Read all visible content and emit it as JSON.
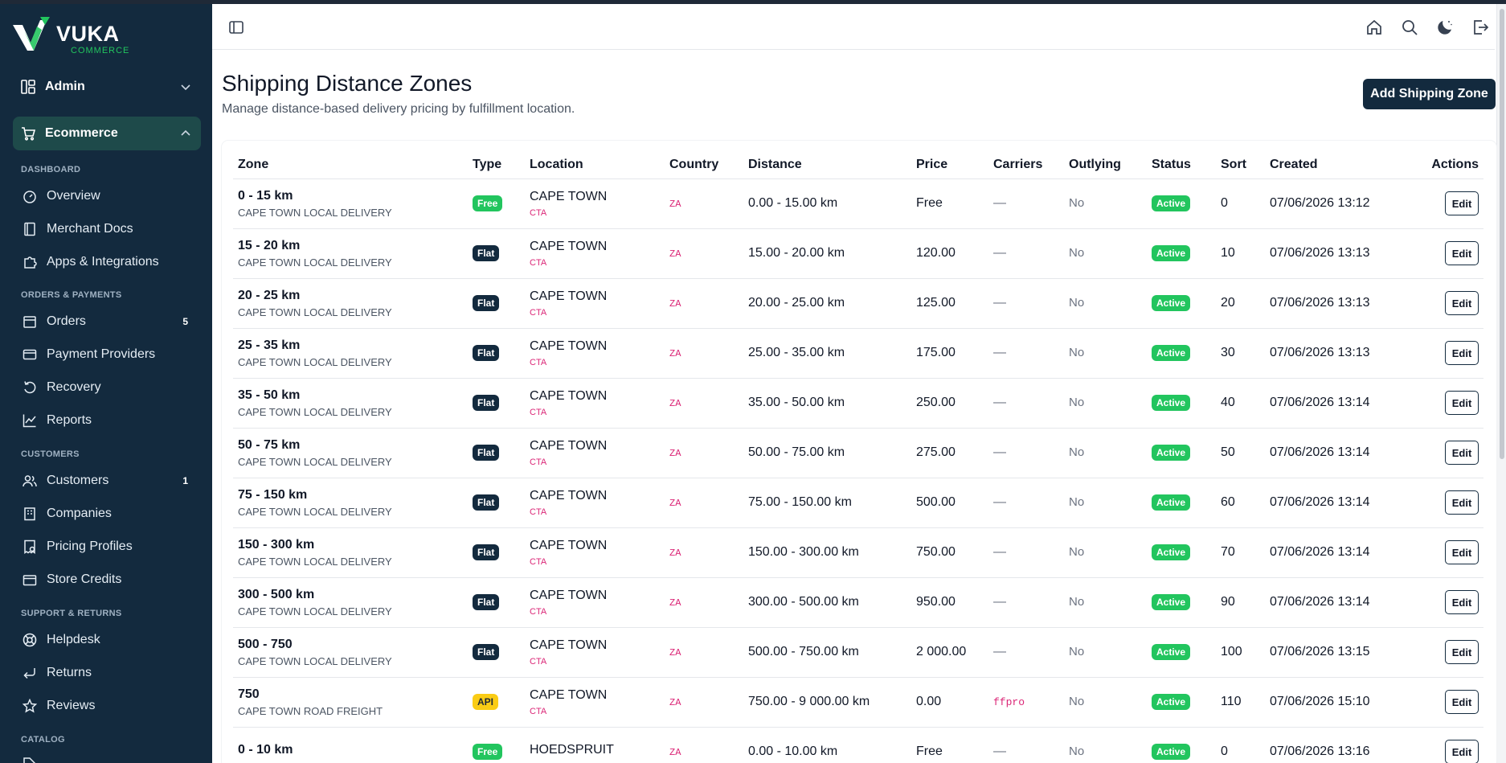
{
  "brand": {
    "name": "VUKA",
    "sub": "COMMERCE",
    "accent": "#22c55e",
    "sidebar_bg": "#132a3e"
  },
  "sidebar": {
    "groups": [
      {
        "label": "Admin",
        "icon": "layout-dashboard-icon",
        "expanded": false
      },
      {
        "label": "Ecommerce",
        "icon": "shopping-cart-icon",
        "expanded": true
      }
    ],
    "sections": [
      {
        "label": "DASHBOARD",
        "items": [
          {
            "label": "Overview",
            "icon": "gauge-icon"
          },
          {
            "label": "Merchant Docs",
            "icon": "book-icon"
          },
          {
            "label": "Apps & Integrations",
            "icon": "puzzle-icon"
          }
        ]
      },
      {
        "label": "ORDERS & PAYMENTS",
        "items": [
          {
            "label": "Orders",
            "icon": "box-icon",
            "count": "5"
          },
          {
            "label": "Payment Providers",
            "icon": "credit-card-icon"
          },
          {
            "label": "Recovery",
            "icon": "rotate-icon"
          },
          {
            "label": "Reports",
            "icon": "chart-line-icon"
          }
        ]
      },
      {
        "label": "CUSTOMERS",
        "items": [
          {
            "label": "Customers",
            "icon": "users-icon",
            "count": "1"
          },
          {
            "label": "Companies",
            "icon": "building-icon"
          },
          {
            "label": "Pricing Profiles",
            "icon": "receipt-icon"
          },
          {
            "label": "Store Credits",
            "icon": "wallet-icon"
          }
        ]
      },
      {
        "label": "SUPPORT & RETURNS",
        "items": [
          {
            "label": "Helpdesk",
            "icon": "lifebuoy-icon"
          },
          {
            "label": "Returns",
            "icon": "return-arrow-icon"
          },
          {
            "label": "Reviews",
            "icon": "star-icon"
          }
        ]
      },
      {
        "label": "CATALOG",
        "items": []
      }
    ]
  },
  "topbar": {
    "icons": [
      "home-icon",
      "search-icon",
      "moon-icon",
      "logout-icon"
    ]
  },
  "header": {
    "title": "Shipping Distance Zones",
    "subtitle": "Manage distance-based delivery pricing by fulfillment location.",
    "add_button": "Add Shipping Zone"
  },
  "table": {
    "columns": [
      "Zone",
      "Type",
      "Location",
      "Country",
      "Distance",
      "Price",
      "Carriers",
      "Outlying",
      "Status",
      "Sort",
      "Created",
      "Actions"
    ],
    "edit_label": "Edit",
    "rows": [
      {
        "zone": "0 - 15 km",
        "zone_sub": "CAPE TOWN LOCAL DELIVERY",
        "type": "Free",
        "location": "CAPE TOWN",
        "loc_code": "CTA",
        "country": "ZA",
        "distance": "0.00 - 15.00 km",
        "price": "Free",
        "carriers": "—",
        "outlying": "No",
        "status": "Active",
        "sort": "0",
        "created": "07/06/2026 13:12"
      },
      {
        "zone": "15 - 20 km",
        "zone_sub": "CAPE TOWN LOCAL DELIVERY",
        "type": "Flat",
        "location": "CAPE TOWN",
        "loc_code": "CTA",
        "country": "ZA",
        "distance": "15.00 - 20.00 km",
        "price": "120.00",
        "carriers": "—",
        "outlying": "No",
        "status": "Active",
        "sort": "10",
        "created": "07/06/2026 13:13"
      },
      {
        "zone": "20 - 25 km",
        "zone_sub": "CAPE TOWN LOCAL DELIVERY",
        "type": "Flat",
        "location": "CAPE TOWN",
        "loc_code": "CTA",
        "country": "ZA",
        "distance": "20.00 - 25.00 km",
        "price": "125.00",
        "carriers": "—",
        "outlying": "No",
        "status": "Active",
        "sort": "20",
        "created": "07/06/2026 13:13"
      },
      {
        "zone": "25 - 35 km",
        "zone_sub": "CAPE TOWN LOCAL DELIVERY",
        "type": "Flat",
        "location": "CAPE TOWN",
        "loc_code": "CTA",
        "country": "ZA",
        "distance": "25.00 - 35.00 km",
        "price": "175.00",
        "carriers": "—",
        "outlying": "No",
        "status": "Active",
        "sort": "30",
        "created": "07/06/2026 13:13"
      },
      {
        "zone": "35 - 50 km",
        "zone_sub": "CAPE TOWN LOCAL DELIVERY",
        "type": "Flat",
        "location": "CAPE TOWN",
        "loc_code": "CTA",
        "country": "ZA",
        "distance": "35.00 - 50.00 km",
        "price": "250.00",
        "carriers": "—",
        "outlying": "No",
        "status": "Active",
        "sort": "40",
        "created": "07/06/2026 13:14"
      },
      {
        "zone": "50 - 75 km",
        "zone_sub": "CAPE TOWN LOCAL DELIVERY",
        "type": "Flat",
        "location": "CAPE TOWN",
        "loc_code": "CTA",
        "country": "ZA",
        "distance": "50.00 - 75.00 km",
        "price": "275.00",
        "carriers": "—",
        "outlying": "No",
        "status": "Active",
        "sort": "50",
        "created": "07/06/2026 13:14"
      },
      {
        "zone": "75 - 150 km",
        "zone_sub": "CAPE TOWN LOCAL DELIVERY",
        "type": "Flat",
        "location": "CAPE TOWN",
        "loc_code": "CTA",
        "country": "ZA",
        "distance": "75.00 - 150.00 km",
        "price": "500.00",
        "carriers": "—",
        "outlying": "No",
        "status": "Active",
        "sort": "60",
        "created": "07/06/2026 13:14"
      },
      {
        "zone": "150 - 300 km",
        "zone_sub": "CAPE TOWN LOCAL DELIVERY",
        "type": "Flat",
        "location": "CAPE TOWN",
        "loc_code": "CTA",
        "country": "ZA",
        "distance": "150.00 - 300.00 km",
        "price": "750.00",
        "carriers": "—",
        "outlying": "No",
        "status": "Active",
        "sort": "70",
        "created": "07/06/2026 13:14"
      },
      {
        "zone": "300 - 500 km",
        "zone_sub": "CAPE TOWN LOCAL DELIVERY",
        "type": "Flat",
        "location": "CAPE TOWN",
        "loc_code": "CTA",
        "country": "ZA",
        "distance": "300.00 - 500.00 km",
        "price": "950.00",
        "carriers": "—",
        "outlying": "No",
        "status": "Active",
        "sort": "90",
        "created": "07/06/2026 13:14"
      },
      {
        "zone": "500 - 750",
        "zone_sub": "CAPE TOWN LOCAL DELIVERY",
        "type": "Flat",
        "location": "CAPE TOWN",
        "loc_code": "CTA",
        "country": "ZA",
        "distance": "500.00 - 750.00 km",
        "price": "2 000.00",
        "carriers": "—",
        "outlying": "No",
        "status": "Active",
        "sort": "100",
        "created": "07/06/2026 13:15"
      },
      {
        "zone": "750",
        "zone_sub": "CAPE TOWN ROAD FREIGHT",
        "type": "API",
        "location": "CAPE TOWN",
        "loc_code": "CTA",
        "country": "ZA",
        "distance": "750.00 - 9 000.00 km",
        "price": "0.00",
        "carriers": "ffpro",
        "outlying": "No",
        "status": "Active",
        "sort": "110",
        "created": "07/06/2026 15:10"
      },
      {
        "zone": "0 - 10 km",
        "zone_sub": "",
        "type": "Free",
        "location": "HOEDSPRUIT",
        "loc_code": "",
        "country": "ZA",
        "distance": "0.00 - 10.00 km",
        "price": "Free",
        "carriers": "—",
        "outlying": "No",
        "status": "Active",
        "sort": "0",
        "created": "07/06/2026 13:16"
      }
    ]
  }
}
